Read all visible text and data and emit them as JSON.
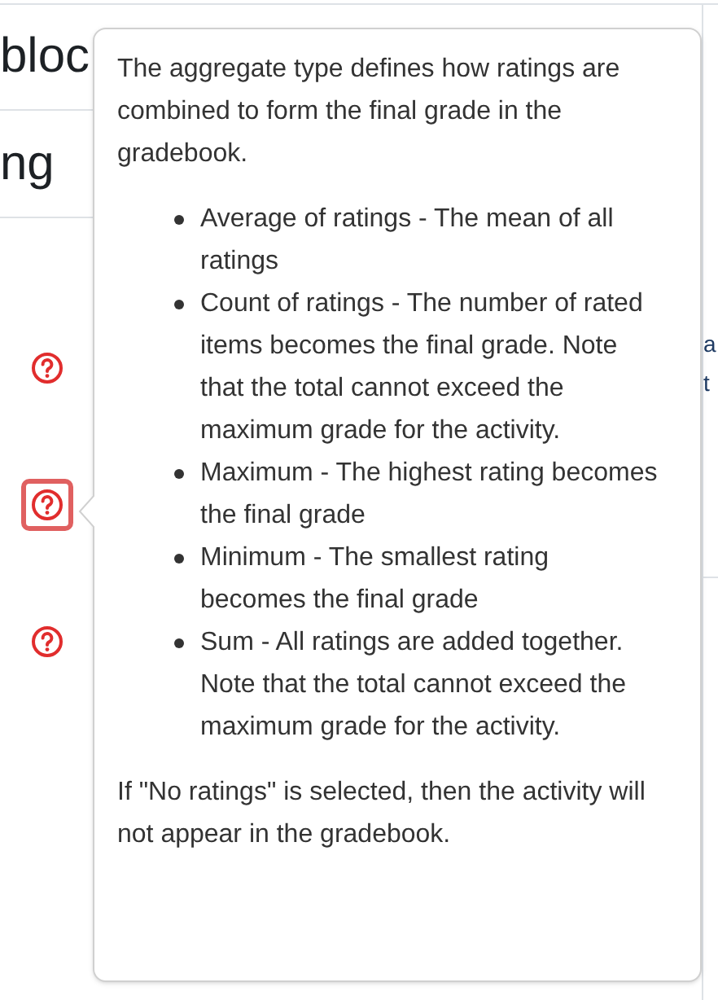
{
  "background": {
    "headings": [
      "bloc",
      "ng"
    ],
    "help_buttons": [
      {
        "focused": false
      },
      {
        "focused": true
      },
      {
        "focused": false
      }
    ],
    "side_texts": [
      "a",
      "t"
    ]
  },
  "popover": {
    "intro": "The aggregate type defines how ratings are combined to form the final grade in the gradebook.",
    "items": [
      "Average of ratings - The mean of all ratings",
      "Count of ratings - The number of rated items becomes the final grade. Note that the total cannot exceed the maximum grade for the activity.",
      "Maximum - The highest rating becomes the final grade",
      "Minimum - The smallest rating becomes the final grade",
      "Sum - All ratings are added together. Note that the total cannot exceed the maximum grade for the activity."
    ],
    "note": "If \"No ratings\" is selected, then the activity will not appear in the gradebook."
  }
}
